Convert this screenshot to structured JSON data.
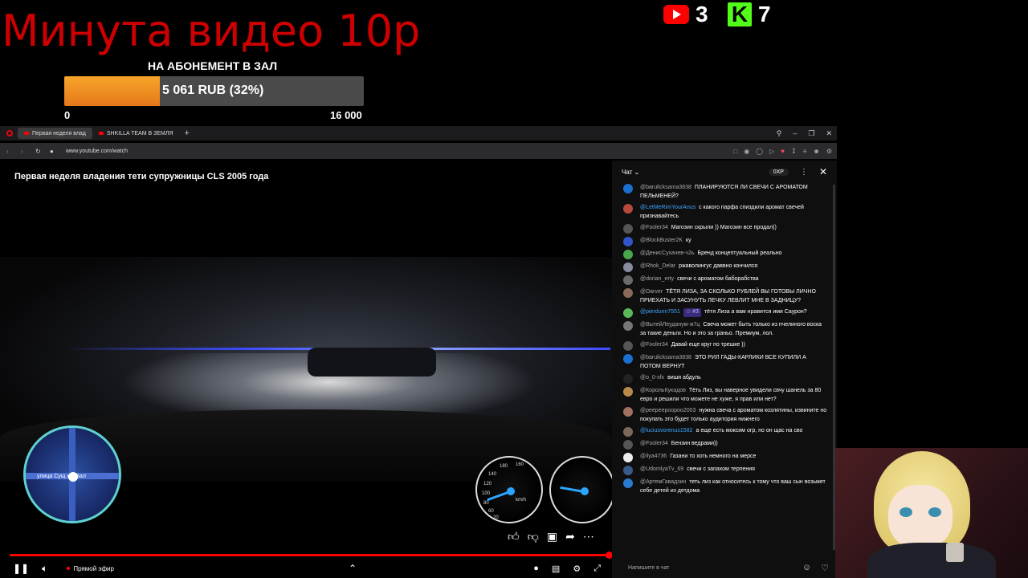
{
  "overlay": {
    "title": "Минута видео 10р",
    "goal": {
      "label": "НА АБОНЕМЕНТ В ЗАЛ",
      "text": "5 061 RUB (32%)",
      "progress_fraction": 0.32,
      "min": "0",
      "max": "16 000"
    },
    "counters": [
      {
        "platform": "youtube-icon",
        "value": "3"
      },
      {
        "platform": "kick-icon",
        "value": "7",
        "logo_letter": "K"
      }
    ]
  },
  "browser": {
    "tabs": [
      {
        "label": "Первая неделя влад",
        "active": true
      },
      {
        "label": "SHKILLA TEAM В ЗЕМЛЯ",
        "active": false
      }
    ],
    "url": "www.youtube.com/watch"
  },
  "video": {
    "title": "Первая неделя владения тети супружницы CLS 2005 года",
    "minimap_street": "улица Сущ      ый Вал",
    "live_label": "Прямой эфир",
    "progress_fraction": 0.99,
    "gauge_labels": [
      "180",
      "160",
      "140",
      "120",
      "100",
      "80",
      "60",
      "40",
      "20",
      "km/h"
    ]
  },
  "chat": {
    "header_label": "Чат",
    "xp_label": "0XP",
    "input_placeholder": "Напишите в чат",
    "messages": [
      {
        "author": "@barulicksama3838",
        "text": "ПЛАНИРУЮТСЯ ЛИ СВЕЧИ С АРОМАТОМ ПЕЛЬМЕНЕЙ?",
        "avatar_color": "#1a6fd1",
        "author_style": ""
      },
      {
        "author": "@LetMeRimYourAnus",
        "text": "с какого парфа спиздили аромат свечей признавайтесь",
        "avatar_color": "#b84a3a",
        "author_style": "blue"
      },
      {
        "author": "@Fooler34",
        "text": "Магозин скрыли )) Магозин все продал))",
        "avatar_color": "#555555",
        "author_style": ""
      },
      {
        "author": "@BlockBuster2K",
        "text": "ку",
        "avatar_color": "#3355cc",
        "author_style": ""
      },
      {
        "author": "@ДенисСухачев-ч2ь",
        "text": "Бренд концептуальный реально",
        "avatar_color": "#4aa64a",
        "author_style": ""
      },
      {
        "author": "@Rhok_Delar",
        "text": "ржаволингус даввно кончился",
        "avatar_color": "#8a8aa0",
        "author_style": ""
      },
      {
        "author": "@dorian_erty",
        "text": "свечи с ароматом баборабства",
        "avatar_color": "#6a6a6a",
        "author_style": ""
      },
      {
        "author": "@Darver",
        "text": "ТЁТЯ ЛИЗА, ЗА СКОЛЬКО РУБЛЕЙ ВЫ ГОТОВЫ ЛИЧНО ПРИЕХАТЬ И ЗАСУНУТЬ ЛЕЧКУ ЛЕВЛИТ МНЕ В ЗАДНИЦУ?",
        "avatar_color": "#8a6a5a",
        "author_style": ""
      },
      {
        "author": "@pierdunn7551",
        "badge": "☆ #3",
        "text": "тётя Лиза а вам нравится имя Саурон?",
        "avatar_color": "#5ab85a",
        "author_style": "blue"
      },
      {
        "author": "@ВытейЛеуданум-ж7ц",
        "text": "Свеча может быть только из пчелиного воска за такие деньги. Но и это за граньо. Премиум, лол.",
        "avatar_color": "#777777",
        "author_style": ""
      },
      {
        "author": "@Fooler34",
        "text": "Давай еще круг по трешке ))",
        "avatar_color": "#555555",
        "author_style": ""
      },
      {
        "author": "@barulicksama3838",
        "text": "ЭТО РИЛ ГАДЫ-КАРЛИКИ ВСЕ КУПИЛИ А ПОТОМ ВЕРНУТ",
        "avatar_color": "#1a6fd1",
        "author_style": ""
      },
      {
        "author": "@o_0-xfx",
        "text": "вишя абдуль",
        "avatar_color": "#222222",
        "author_style": ""
      },
      {
        "author": "@КорольКукадов",
        "text": "Тёть Лиз, вы наверное увидели свчу шанель за 80 евро и решили что можете не хуже, я прав или нет?",
        "avatar_color": "#b88a4a",
        "author_style": ""
      },
      {
        "author": "@peepeepoopoo2003",
        "text": "нужна свеча с ароматом козлятины, извините но покупать это будет только аудитория нижнего",
        "avatar_color": "#a07060",
        "author_style": ""
      },
      {
        "author": "@luciusvorenus1582",
        "text": "а еще есть моксим огр, но он щас на сво",
        "avatar_color": "#7a6a5a",
        "author_style": "blue"
      },
      {
        "author": "@Fooler34",
        "text": "Бензин ведрами))",
        "avatar_color": "#555555",
        "author_style": ""
      },
      {
        "author": "@ilya4736",
        "text": "Газани то хоть немного на мерсе",
        "avatar_color": "#eeeeee",
        "author_style": ""
      },
      {
        "author": "@UdomlyaTv_69",
        "text": "свечи с запахом терпения",
        "avatar_color": "#3a5a8a",
        "author_style": ""
      },
      {
        "author": "@АртемГавадзин",
        "text": "теть лиз как относитесь к тому что ваш сын возьмет себе детей из детдома",
        "avatar_color": "#2a7ad1",
        "author_style": ""
      }
    ]
  },
  "colors": {
    "title_red": "#cc0000",
    "goal_orange": "#f28c22",
    "progress_red": "#ff0000",
    "kick_green": "#53fc18"
  }
}
